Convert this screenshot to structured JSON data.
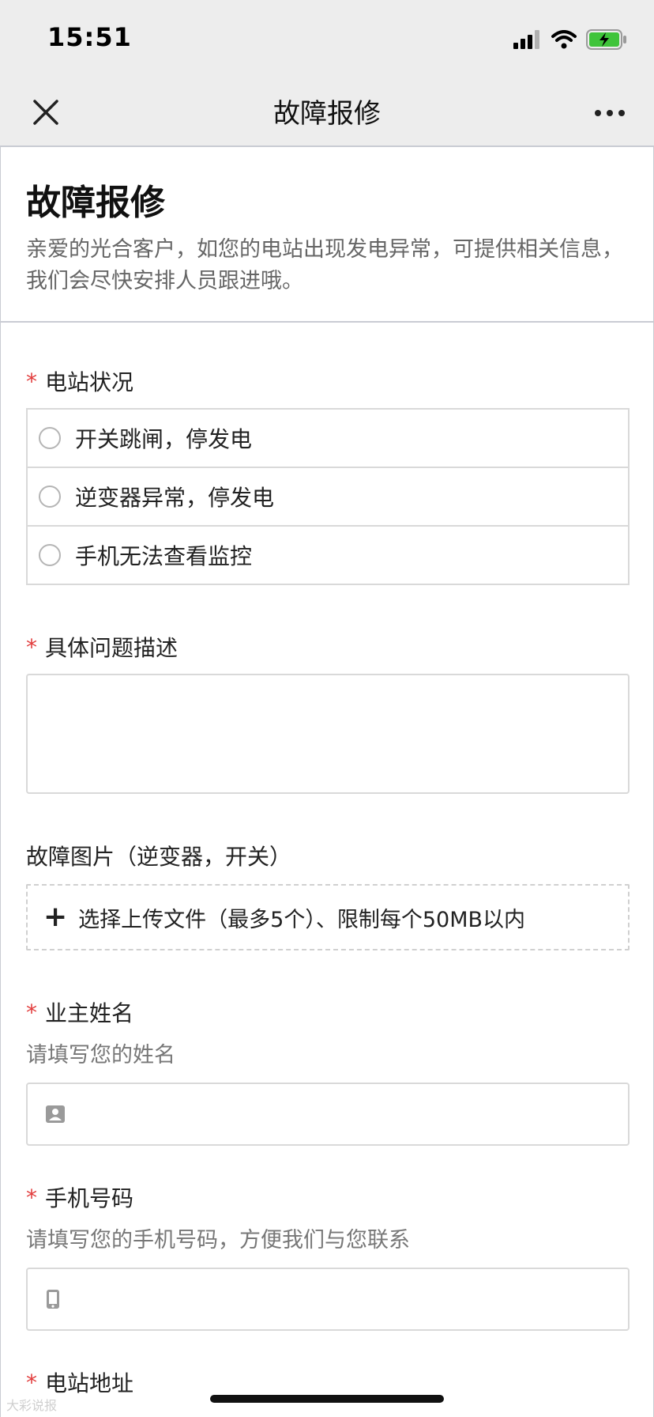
{
  "status_bar": {
    "time": "15:51",
    "icons": [
      "signal-icon",
      "wifi-icon",
      "battery-charging-icon"
    ]
  },
  "nav": {
    "title": "故障报修",
    "close_icon": "close-icon",
    "more_icon": "more-icon"
  },
  "form": {
    "title": "故障报修",
    "description": "亲爱的光合客户，如您的电站出现发电异常，可提供相关信息，我们会尽快安排人员跟进哦。"
  },
  "fields": {
    "station_status": {
      "required_mark": "*",
      "label": "电站状况",
      "options": [
        "开关跳闸，停发电",
        "逆变器异常，停发电",
        "手机无法查看监控"
      ]
    },
    "problem_desc": {
      "required_mark": "*",
      "label": "具体问题描述",
      "value": ""
    },
    "fault_images": {
      "label": "故障图片（逆变器，开关）",
      "upload_label": "选择上传文件（最多5个）、限制每个50MB以内"
    },
    "owner_name": {
      "required_mark": "*",
      "label": "业主姓名",
      "hint": "请填写您的姓名",
      "icon": "contact-card-icon",
      "value": ""
    },
    "phone": {
      "required_mark": "*",
      "label": "手机号码",
      "hint": "请填写您的手机号码，方便我们与您联系",
      "icon": "phone-icon",
      "value": ""
    },
    "address": {
      "required_mark": "*",
      "label": "电站地址"
    }
  },
  "watermark": "大彩说报"
}
